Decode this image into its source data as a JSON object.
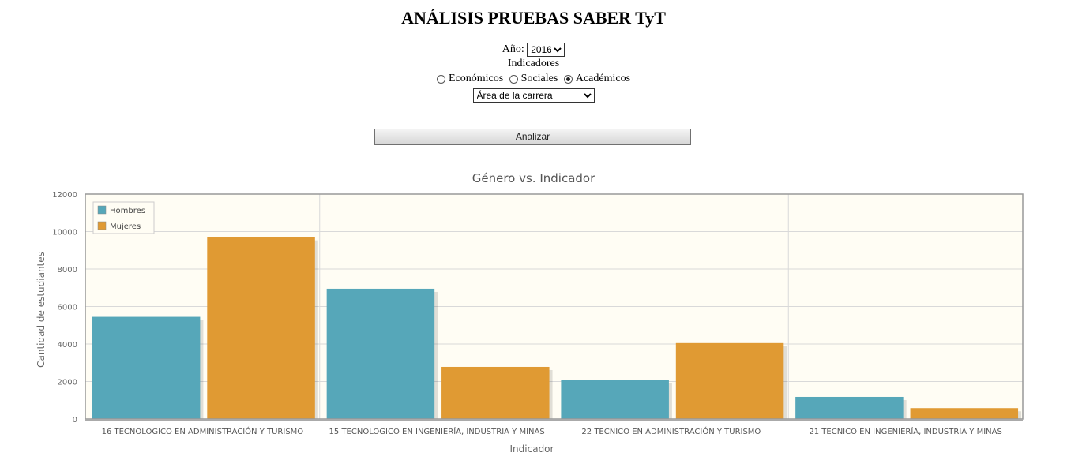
{
  "page": {
    "title": "ANÁLISIS PRUEBAS SABER TyT"
  },
  "form": {
    "year_label": "Año:",
    "year_value": "2016",
    "indicators_label": "Indicadores",
    "radios": [
      {
        "label": "Económicos",
        "checked": false
      },
      {
        "label": "Sociales",
        "checked": false
      },
      {
        "label": "Académicos",
        "checked": true
      }
    ],
    "indicator_select_value": "Área de la carrera",
    "analyze_button": "Analizar"
  },
  "colors": {
    "hombres": "#56a7b9",
    "mujeres": "#e09a33",
    "plot_background": "#fffdf4"
  },
  "chart_data": {
    "type": "bar",
    "title": "Género vs. Indicador",
    "xlabel": "Indicador",
    "ylabel": "Cantidad de estudiantes",
    "ylim": [
      0,
      12000
    ],
    "yticks": [
      "0",
      "2000",
      "4000",
      "6000",
      "8000",
      "10000",
      "12000"
    ],
    "categories": [
      "16 TECNOLOGICO EN ADMINISTRACIÓN Y TURISMO",
      "15 TECNOLOGICO EN INGENIERÍA, INDUSTRIA Y MINAS",
      "22 TECNICO EN ADMINISTRACIÓN Y TURISMO",
      "21 TECNICO EN INGENIERÍA, INDUSTRIA Y MINAS"
    ],
    "series": [
      {
        "name": "Hombres",
        "values": [
          5450,
          6950,
          2100,
          1180
        ]
      },
      {
        "name": "Mujeres",
        "values": [
          9700,
          2780,
          4050,
          580
        ]
      }
    ],
    "legend_position": "top-left",
    "grid": true
  }
}
